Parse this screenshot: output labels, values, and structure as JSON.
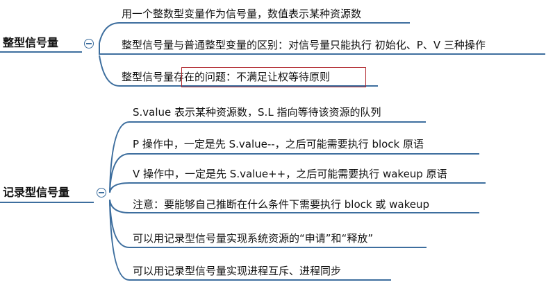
{
  "groups": [
    {
      "title": "整型信号量",
      "items": [
        {
          "text": "用一个整数型变量作为信号量，数值表示某种资源数"
        },
        {
          "text": "整型信号量与普通整型变量的区别：对信号量只能执行 初始化、P、V 三种操作"
        },
        {
          "text_plain": "整型信号量",
          "text_highlight": "存在的问题：不满足让权等待原则"
        }
      ]
    },
    {
      "title": "记录型信号量",
      "items": [
        {
          "text": "S.value 表示某种资源数，S.L 指向等待该资源的队列"
        },
        {
          "text": "P 操作中，一定是先 S.value--，之后可能需要执行 block 原语"
        },
        {
          "text": "V 操作中，一定是先 S.value++，之后可能需要执行 wakeup 原语"
        },
        {
          "text": "注意：要能够自己推断在什么条件下需要执行 block 或 wakeup"
        },
        {
          "text": "可以用记录型信号量实现系统资源的“申请”和“释放”"
        },
        {
          "text": "可以用记录型信号量实现进程互斥、进程同步"
        }
      ]
    }
  ],
  "colors": {
    "line": "#3d6e9e",
    "highlight": "#b0262c"
  }
}
